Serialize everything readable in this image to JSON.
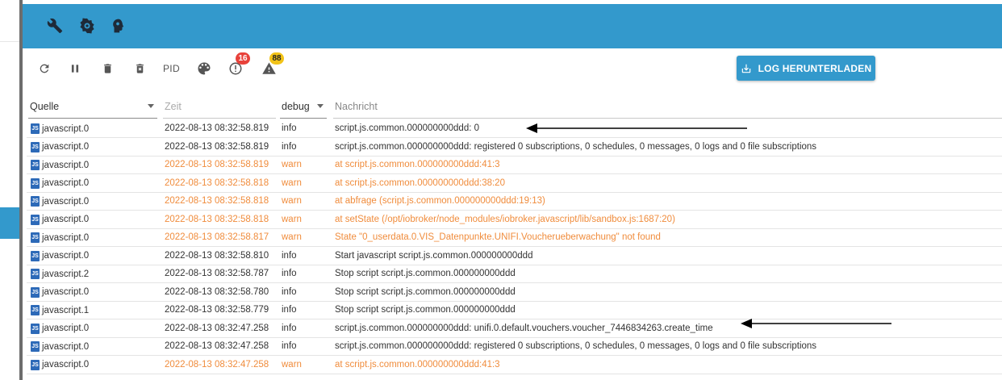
{
  "app_bar": {
    "icons": [
      "wrench-icon",
      "gear-icon",
      "head-icon"
    ]
  },
  "toolbar": {
    "icons": [
      "refresh-icon",
      "pause-icon",
      "trash-icon",
      "trash-x-icon",
      "palette-icon",
      "error-icon",
      "warning-icon"
    ],
    "pid_label": "PID",
    "error_count": "16",
    "warning_count": "88",
    "download_label": "LOG HERUNTERLADEN"
  },
  "table": {
    "headers": {
      "source": "Quelle",
      "time": "Zeit",
      "severity": "debug",
      "message": "Nachricht"
    },
    "rows": [
      {
        "source": "javascript.0",
        "time": "2022-08-13 08:32:58.819",
        "severity": "info",
        "message": "script.js.common.000000000ddd: 0"
      },
      {
        "source": "javascript.0",
        "time": "2022-08-13 08:32:58.819",
        "severity": "info",
        "message": "script.js.common.000000000ddd: registered 0 subscriptions, 0 schedules, 0 messages, 0 logs and 0 file subscriptions"
      },
      {
        "source": "javascript.0",
        "time": "2022-08-13 08:32:58.819",
        "severity": "warn",
        "message": "at script.js.common.000000000ddd:41:3"
      },
      {
        "source": "javascript.0",
        "time": "2022-08-13 08:32:58.818",
        "severity": "warn",
        "message": "at script.js.common.000000000ddd:38:20"
      },
      {
        "source": "javascript.0",
        "time": "2022-08-13 08:32:58.818",
        "severity": "warn",
        "message": "at abfrage (script.js.common.000000000ddd:19:13)"
      },
      {
        "source": "javascript.0",
        "time": "2022-08-13 08:32:58.818",
        "severity": "warn",
        "message": "at setState (/opt/iobroker/node_modules/iobroker.javascript/lib/sandbox.js:1687:20)"
      },
      {
        "source": "javascript.0",
        "time": "2022-08-13 08:32:58.817",
        "severity": "warn",
        "message": "State \"0_userdata.0.VIS_Datenpunkte.UNIFI.Voucherueberwachung\" not found"
      },
      {
        "source": "javascript.0",
        "time": "2022-08-13 08:32:58.810",
        "severity": "info",
        "message": "Start javascript script.js.common.000000000ddd"
      },
      {
        "source": "javascript.2",
        "time": "2022-08-13 08:32:58.787",
        "severity": "info",
        "message": "Stop script script.js.common.000000000ddd"
      },
      {
        "source": "javascript.0",
        "time": "2022-08-13 08:32:58.780",
        "severity": "info",
        "message": "Stop script script.js.common.000000000ddd"
      },
      {
        "source": "javascript.1",
        "time": "2022-08-13 08:32:58.779",
        "severity": "info",
        "message": "Stop script script.js.common.000000000ddd"
      },
      {
        "source": "javascript.0",
        "time": "2022-08-13 08:32:47.258",
        "severity": "info",
        "message": "script.js.common.000000000ddd: unifi.0.default.vouchers.voucher_7446834263.create_time"
      },
      {
        "source": "javascript.0",
        "time": "2022-08-13 08:32:47.258",
        "severity": "info",
        "message": "script.js.common.000000000ddd: registered 0 subscriptions, 0 schedules, 0 messages, 0 logs and 0 file subscriptions"
      },
      {
        "source": "javascript.0",
        "time": "2022-08-13 08:32:47.258",
        "severity": "warn",
        "message": "at script.js.common.000000000ddd:41:3"
      }
    ]
  },
  "colors": {
    "accent": "#3399cc",
    "warn": "#f08c3c",
    "error_badge": "#e8423b",
    "warning_badge": "#f2c318"
  }
}
